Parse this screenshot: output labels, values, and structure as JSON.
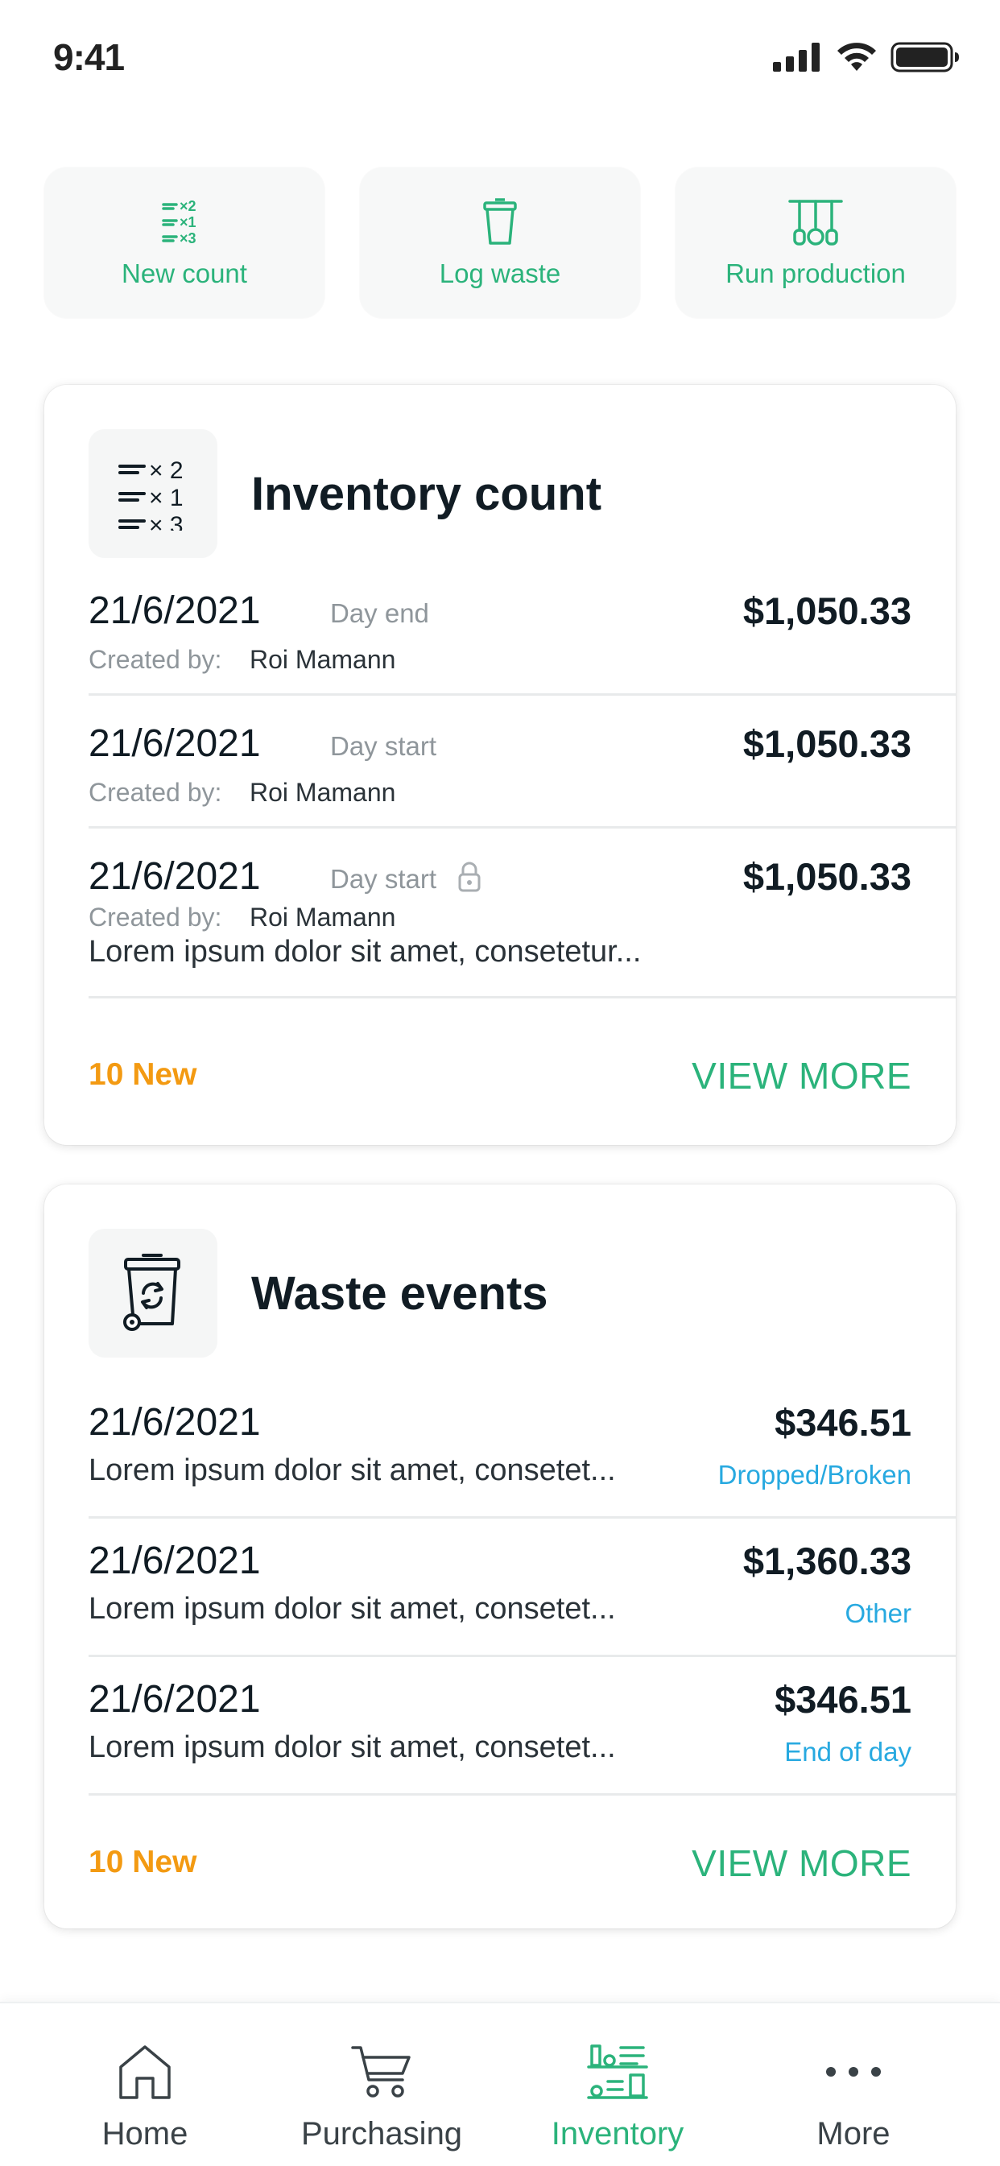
{
  "status_bar": {
    "time": "9:41"
  },
  "quick_actions": [
    {
      "label": "New count",
      "icon": "count-list-icon"
    },
    {
      "label": "Log waste",
      "icon": "trash-bin-icon"
    },
    {
      "label": "Run production",
      "icon": "kitchen-tools-icon"
    }
  ],
  "inventory_count": {
    "title": "Inventory count",
    "created_by_label": "Created by:",
    "rows": [
      {
        "date": "21/6/2021",
        "tag": "Day end",
        "amount": "$1,050.33",
        "user": "Roi Mamann"
      },
      {
        "date": "21/6/2021",
        "tag": "Day start",
        "amount": "$1,050.33",
        "user": "Roi Mamann"
      },
      {
        "date": "21/6/2021",
        "tag": "Day start",
        "amount": "$1,050.33",
        "user": "Roi Mamann",
        "note": "Lorem ipsum dolor sit amet, consetetur...",
        "locked": true
      }
    ],
    "new_count": "10 New",
    "view_more": "VIEW MORE"
  },
  "waste_events": {
    "title": "Waste events",
    "rows": [
      {
        "date": "21/6/2021",
        "amount": "$346.51",
        "note": "Lorem ipsum dolor sit amet, consetet...",
        "reason": "Dropped/Broken"
      },
      {
        "date": "21/6/2021",
        "amount": "$1,360.33",
        "note": "Lorem ipsum dolor sit amet, consetet...",
        "reason": "Other"
      },
      {
        "date": "21/6/2021",
        "amount": "$346.51",
        "note": "Lorem ipsum dolor sit amet, consetet...",
        "reason": "End of day"
      }
    ],
    "new_count": "10 New",
    "view_more": "VIEW MORE"
  },
  "tab_bar": {
    "active": "Inventory",
    "tabs": [
      {
        "label": "Home",
        "icon": "home-icon"
      },
      {
        "label": "Purchasing",
        "icon": "cart-icon"
      },
      {
        "label": "Inventory",
        "icon": "inventory-shelves-icon"
      },
      {
        "label": "More",
        "icon": "more-dots-icon"
      }
    ]
  },
  "colors": {
    "accent_green": "#2bb37b",
    "new_orange": "#f39a12",
    "reason_blue": "#27a9e0",
    "text_dark": "#111c24",
    "text_muted": "#8f969b"
  }
}
